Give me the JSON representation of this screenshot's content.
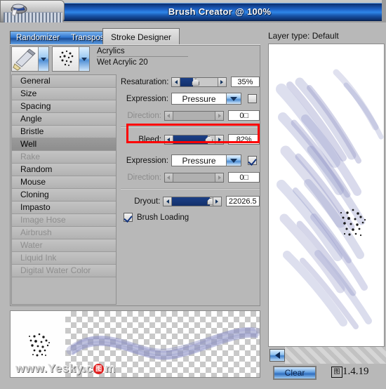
{
  "window": {
    "title": "Brush Creator @ 100%",
    "grabber_icon": "paint-brush-icon"
  },
  "tabs": {
    "inactive": [
      "Randomizer",
      "Transposer"
    ],
    "active": "Stroke Designer"
  },
  "brush": {
    "category": "Acrylics",
    "variant": "Wet Acrylic 20",
    "category_icon": "brush-tip-icon",
    "variant_icon": "dab-pattern-icon"
  },
  "categories": [
    {
      "label": "General",
      "state": "enabled"
    },
    {
      "label": "Size",
      "state": "enabled"
    },
    {
      "label": "Spacing",
      "state": "enabled"
    },
    {
      "label": "Angle",
      "state": "enabled"
    },
    {
      "label": "Bristle",
      "state": "enabled"
    },
    {
      "label": "Well",
      "state": "selected"
    },
    {
      "label": "Rake",
      "state": "disabled"
    },
    {
      "label": "Random",
      "state": "enabled"
    },
    {
      "label": "Mouse",
      "state": "enabled"
    },
    {
      "label": "Cloning",
      "state": "enabled"
    },
    {
      "label": "Impasto",
      "state": "enabled"
    },
    {
      "label": "Image Hose",
      "state": "disabled"
    },
    {
      "label": "Airbrush",
      "state": "disabled"
    },
    {
      "label": "Water",
      "state": "disabled"
    },
    {
      "label": "Liquid Ink",
      "state": "disabled"
    },
    {
      "label": "Digital Water Color",
      "state": "disabled"
    }
  ],
  "controls": {
    "resaturation": {
      "label": "Resaturation:",
      "value": "35%",
      "percent": 35
    },
    "expression1": {
      "label": "Expression:",
      "value": "Pressure",
      "checkbox": false
    },
    "direction1": {
      "label": "Direction:",
      "value": "0□",
      "percent": 0,
      "disabled": true
    },
    "bleed": {
      "label": "Bleed:",
      "value": "82%",
      "percent": 82,
      "highlighted": true
    },
    "expression2": {
      "label": "Expression:",
      "value": "Pressure",
      "checkbox": true
    },
    "direction2": {
      "label": "Direction:",
      "value": "0□",
      "percent": 0,
      "disabled": true
    },
    "dryout": {
      "label": "Dryout:",
      "value": "22026.5",
      "percent": 93
    },
    "brush_loading": {
      "label": "Brush Loading",
      "checked": true
    }
  },
  "preview": {
    "layer_type": "Layer type: Default",
    "back_icon": "left-arrow-icon",
    "clear_label": "Clear"
  },
  "footer": {
    "watermark_prefix": "www.Yesky.c",
    "watermark_seal": "图",
    "watermark_suffix": "m",
    "figure_caption": "1.4.19",
    "figure_glyph": "图"
  },
  "colors": {
    "titlebar_blue": "#1e63c8",
    "highlight_red": "#ff0000",
    "slider_fill": "#13306b",
    "stroke_paint": "#8b8fc4"
  }
}
